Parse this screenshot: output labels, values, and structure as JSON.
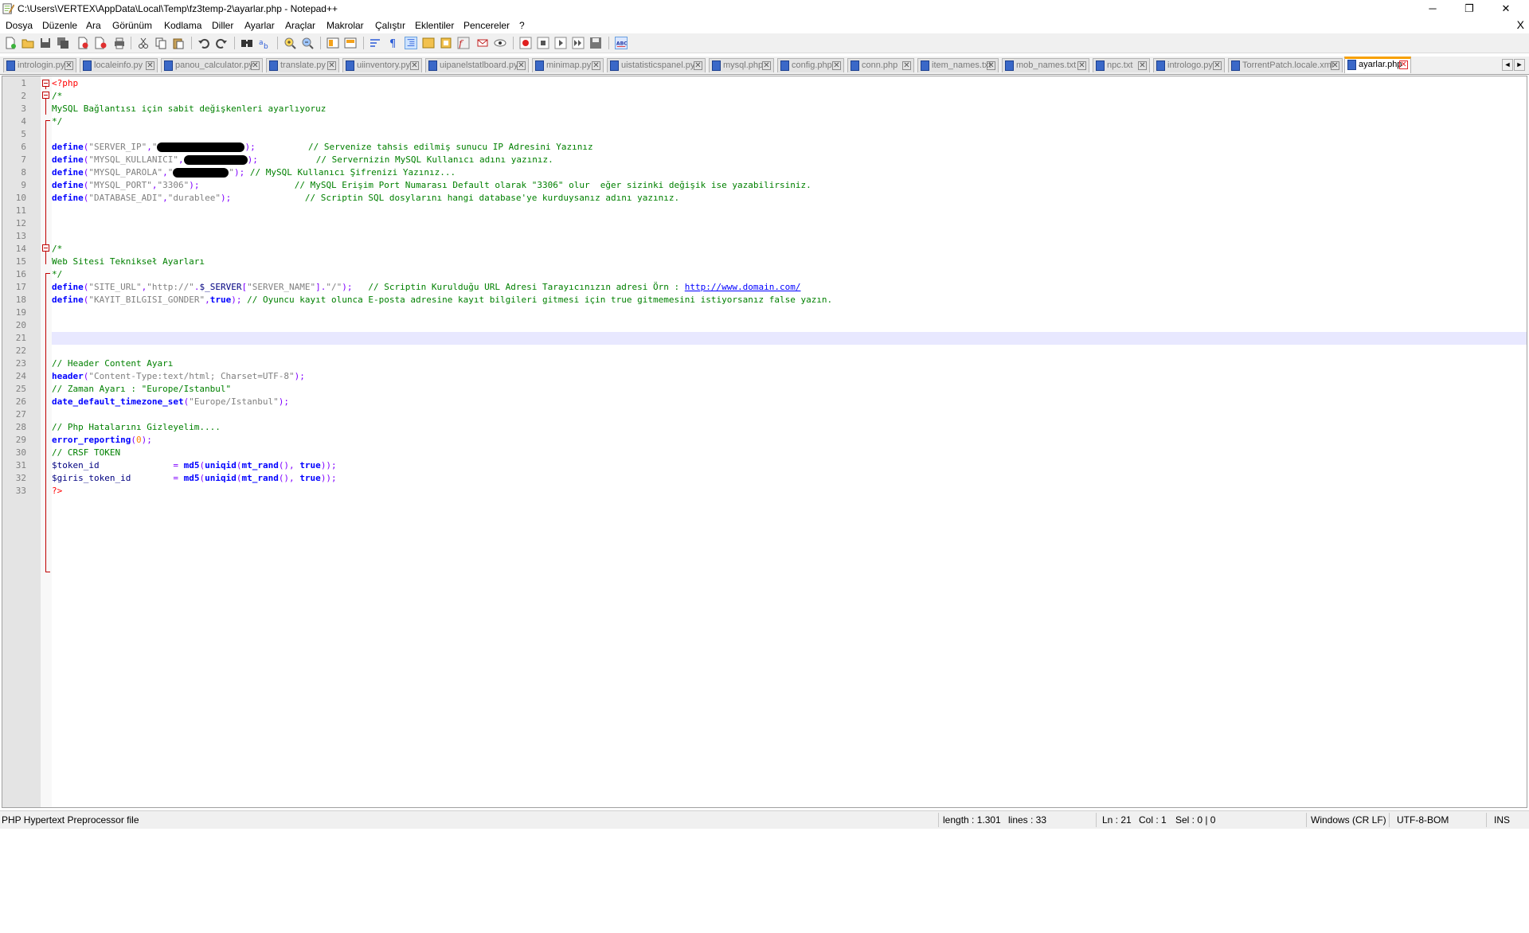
{
  "window": {
    "title": "C:\\Users\\VERTEX\\AppData\\Local\\Temp\\fz3temp-2\\ayarlar.php - Notepad++",
    "app_icon": "notepad-plus-plus-icon",
    "minimize": "─",
    "restore": "❐",
    "close": "✕"
  },
  "menu": {
    "items": [
      "Dosya",
      "Düzenle",
      "Ara",
      "Görünüm",
      "Kodlama",
      "Diller",
      "Ayarlar",
      "Araçlar",
      "Makrolar",
      "Çalıştır",
      "Eklentiler",
      "Pencereler",
      "?"
    ],
    "doc_close": "X"
  },
  "toolbar": {
    "icons": [
      "new-file-icon",
      "open-file-icon",
      "save-icon",
      "save-all-icon",
      "close-icon",
      "close-all-icon",
      "print-icon",
      "cut-icon",
      "copy-icon",
      "paste-icon",
      "undo-icon",
      "redo-icon",
      "find-icon",
      "replace-icon",
      "zoom-in-icon",
      "zoom-out-icon",
      "sync-vertical-icon",
      "sync-horizontal-icon",
      "word-wrap-icon",
      "show-all-chars-icon",
      "indent-guide-icon",
      "language-icon",
      "folder-workspace-icon",
      "function-list-icon",
      "document-map-icon",
      "monitoring-icon",
      "record-macro-icon",
      "stop-record-icon",
      "play-macro-icon",
      "run-macro-multiple-icon",
      "save-macro-icon",
      "spell-check-icon"
    ]
  },
  "tabs": [
    {
      "label": "intrologin.py",
      "active": false
    },
    {
      "label": "localeinfo.py",
      "active": false
    },
    {
      "label": "panou_calculator.py",
      "active": false
    },
    {
      "label": "translate.py",
      "active": false
    },
    {
      "label": "uiinventory.py",
      "active": false
    },
    {
      "label": "uipanelstatlboard.py",
      "active": false
    },
    {
      "label": "minimap.py",
      "active": false
    },
    {
      "label": "uistatisticspanel.py",
      "active": false
    },
    {
      "label": "mysql.php",
      "active": false
    },
    {
      "label": "config.php",
      "active": false
    },
    {
      "label": "conn.php",
      "active": false
    },
    {
      "label": "item_names.txt",
      "active": false
    },
    {
      "label": "mob_names.txt",
      "active": false
    },
    {
      "label": "npc.txt",
      "active": false
    },
    {
      "label": "intrologo.py",
      "active": false
    },
    {
      "label": "TorrentPatch.locale.xml",
      "active": false
    },
    {
      "label": "ayarlar.php",
      "active": true
    }
  ],
  "tab_scroll": {
    "left": "◄",
    "right": "►"
  },
  "editor": {
    "current_line": 21,
    "line_numbers": [
      "1",
      "2",
      "3",
      "4",
      "5",
      "6",
      "7",
      "8",
      "9",
      "10",
      "11",
      "12",
      "13",
      "14",
      "15",
      "16",
      "17",
      "18",
      "19",
      "20",
      "21",
      "22",
      "23",
      "24",
      "25",
      "26",
      "27",
      "28",
      "29",
      "30",
      "31",
      "32",
      "33"
    ],
    "lines": [
      [
        {
          "c": "tag",
          "t": "<?php"
        }
      ],
      [
        {
          "c": "cmt",
          "t": "/*"
        }
      ],
      [
        {
          "c": "cmt",
          "t": "MySQL Bağlantısı için sabit değişkenleri ayarlıyoruz"
        }
      ],
      [
        {
          "c": "cmt",
          "t": "*/"
        }
      ],
      [],
      [
        {
          "c": "kw",
          "t": "define"
        },
        {
          "c": "op",
          "t": "("
        },
        {
          "c": "str",
          "t": "\"SERVER_IP\""
        },
        {
          "c": "op",
          "t": ","
        },
        {
          "c": "str",
          "t": "\""
        },
        {
          "c": "redact",
          "t": "110"
        },
        {
          "c": "op",
          "t": ");"
        },
        {
          "c": "plain",
          "t": "          "
        },
        {
          "c": "cmt",
          "t": "// Servenize tahsis edilmiş sunucu IP Adresini Yazınız"
        }
      ],
      [
        {
          "c": "kw",
          "t": "define"
        },
        {
          "c": "op",
          "t": "("
        },
        {
          "c": "str",
          "t": "\"MYSQL_KULLANICI\""
        },
        {
          "c": "op",
          "t": ","
        },
        {
          "c": "redact",
          "t": "80"
        },
        {
          "c": "op",
          "t": ");"
        },
        {
          "c": "plain",
          "t": "           "
        },
        {
          "c": "cmt",
          "t": "// Servernizin MySQL Kullanıcı adını yazınız."
        }
      ],
      [
        {
          "c": "kw",
          "t": "define"
        },
        {
          "c": "op",
          "t": "("
        },
        {
          "c": "str",
          "t": "\"MYSQL_PAROLA\""
        },
        {
          "c": "op",
          "t": ","
        },
        {
          "c": "str",
          "t": "\""
        },
        {
          "c": "redact",
          "t": "70"
        },
        {
          "c": "str",
          "t": "\""
        },
        {
          "c": "op",
          "t": ");"
        },
        {
          "c": "plain",
          "t": " "
        },
        {
          "c": "cmt",
          "t": "// MySQL Kullanıcı Şifrenizi Yazınız..."
        }
      ],
      [
        {
          "c": "kw",
          "t": "define"
        },
        {
          "c": "op",
          "t": "("
        },
        {
          "c": "str",
          "t": "\"MYSQL_PORT\""
        },
        {
          "c": "op",
          "t": ","
        },
        {
          "c": "str",
          "t": "\"3306\""
        },
        {
          "c": "op",
          "t": ");"
        },
        {
          "c": "plain",
          "t": "                  "
        },
        {
          "c": "cmt",
          "t": "// MySQL Erişim Port Numarası Default olarak \"3306\" olur  eğer sizinki değişik ise yazabilirsiniz."
        }
      ],
      [
        {
          "c": "kw",
          "t": "define"
        },
        {
          "c": "op",
          "t": "("
        },
        {
          "c": "str",
          "t": "\"DATABASE_ADI\""
        },
        {
          "c": "op",
          "t": ","
        },
        {
          "c": "str",
          "t": "\"durablee\""
        },
        {
          "c": "op",
          "t": ");"
        },
        {
          "c": "plain",
          "t": "              "
        },
        {
          "c": "cmt",
          "t": "// Scriptin SQL dosylarını hangi database'ye kurduysanız adını yazınız."
        }
      ],
      [],
      [],
      [],
      [
        {
          "c": "cmt",
          "t": "/*"
        }
      ],
      [
        {
          "c": "cmt",
          "t": "Web Sitesi Teknikseł Ayarları"
        }
      ],
      [
        {
          "c": "cmt",
          "t": "*/"
        }
      ],
      [
        {
          "c": "kw",
          "t": "define"
        },
        {
          "c": "op",
          "t": "("
        },
        {
          "c": "str",
          "t": "\"SITE_URL\""
        },
        {
          "c": "op",
          "t": ","
        },
        {
          "c": "str",
          "t": "\"http://\""
        },
        {
          "c": "op",
          "t": "."
        },
        {
          "c": "var",
          "t": "$_SERVER"
        },
        {
          "c": "op",
          "t": "["
        },
        {
          "c": "str",
          "t": "\"SERVER_NAME\""
        },
        {
          "c": "op",
          "t": "]."
        },
        {
          "c": "str",
          "t": "\"/\""
        },
        {
          "c": "op",
          "t": ");"
        },
        {
          "c": "plain",
          "t": "   "
        },
        {
          "c": "cmt",
          "t": "// Scriptin Kurulduğu URL Adresi Tarayıcınızın adresi Örn : "
        },
        {
          "c": "url",
          "t": "http://www.domain.com/"
        }
      ],
      [
        {
          "c": "kw",
          "t": "define"
        },
        {
          "c": "op",
          "t": "("
        },
        {
          "c": "str",
          "t": "\"KAYIT_BILGISI_GONDER\""
        },
        {
          "c": "op",
          "t": ","
        },
        {
          "c": "kw",
          "t": "true"
        },
        {
          "c": "op",
          "t": ");"
        },
        {
          "c": "plain",
          "t": " "
        },
        {
          "c": "cmt",
          "t": "// Oyuncu kayıt olunca E-posta adresine kayıt bilgileri gitmesi için true gitmemesini istiyorsanız false yazın."
        }
      ],
      [],
      [],
      [],
      [],
      [
        {
          "c": "cmt",
          "t": "// Header Content Ayarı"
        }
      ],
      [
        {
          "c": "kw",
          "t": "header"
        },
        {
          "c": "op",
          "t": "("
        },
        {
          "c": "str",
          "t": "\"Content-Type:text/html; Charset=UTF-8\""
        },
        {
          "c": "op",
          "t": ");"
        }
      ],
      [
        {
          "c": "cmt",
          "t": "// Zaman Ayarı : \"Europe/Istanbul\""
        }
      ],
      [
        {
          "c": "kw",
          "t": "date_default_timezone_set"
        },
        {
          "c": "op",
          "t": "("
        },
        {
          "c": "str",
          "t": "\"Europe/Istanbul\""
        },
        {
          "c": "op",
          "t": ");"
        }
      ],
      [],
      [
        {
          "c": "cmt",
          "t": "// Php Hatalarını Gizleyelim...."
        }
      ],
      [
        {
          "c": "kw",
          "t": "error_reporting"
        },
        {
          "c": "op",
          "t": "("
        },
        {
          "c": "num",
          "t": "0"
        },
        {
          "c": "op",
          "t": ");"
        }
      ],
      [
        {
          "c": "cmt",
          "t": "// CRSF TOKEN"
        }
      ],
      [
        {
          "c": "var",
          "t": "$token_id"
        },
        {
          "c": "plain",
          "t": "              "
        },
        {
          "c": "op",
          "t": "="
        },
        {
          "c": "plain",
          "t": " "
        },
        {
          "c": "kw",
          "t": "md5"
        },
        {
          "c": "op",
          "t": "("
        },
        {
          "c": "kw",
          "t": "uniqid"
        },
        {
          "c": "op",
          "t": "("
        },
        {
          "c": "kw",
          "t": "mt_rand"
        },
        {
          "c": "op",
          "t": "(),"
        },
        {
          "c": "plain",
          "t": " "
        },
        {
          "c": "kw",
          "t": "true"
        },
        {
          "c": "op",
          "t": "));"
        }
      ],
      [
        {
          "c": "var",
          "t": "$giris_token_id"
        },
        {
          "c": "plain",
          "t": "        "
        },
        {
          "c": "op",
          "t": "="
        },
        {
          "c": "plain",
          "t": " "
        },
        {
          "c": "kw",
          "t": "md5"
        },
        {
          "c": "op",
          "t": "("
        },
        {
          "c": "kw",
          "t": "uniqid"
        },
        {
          "c": "op",
          "t": "("
        },
        {
          "c": "kw",
          "t": "mt_rand"
        },
        {
          "c": "op",
          "t": "(),"
        },
        {
          "c": "plain",
          "t": " "
        },
        {
          "c": "kw",
          "t": "true"
        },
        {
          "c": "op",
          "t": "));"
        }
      ],
      [
        {
          "c": "tag",
          "t": "?>"
        }
      ]
    ]
  },
  "status": {
    "file_type": "PHP Hypertext Preprocessor file",
    "length": "length : 1.301",
    "lines": "lines : 33",
    "ln": "Ln : 21",
    "col": "Col : 1",
    "sel": "Sel : 0 | 0",
    "eol": "Windows (CR LF)",
    "encoding": "UTF-8-BOM",
    "mode": "INS"
  },
  "colors": {
    "keyword": "#0000ff",
    "string": "#808080",
    "comment": "#008000",
    "php_tag": "#ff0000",
    "operator": "#8000ff",
    "current_line": "#e8e8ff",
    "active_tab_accent": "#f7a000"
  }
}
